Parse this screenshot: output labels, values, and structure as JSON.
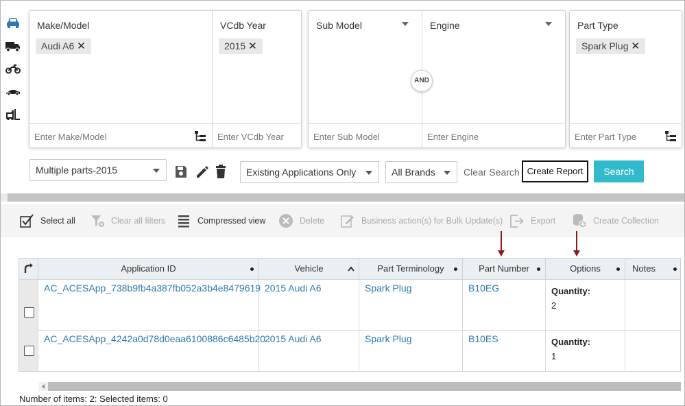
{
  "filters": {
    "make_model": {
      "header": "Make/Model",
      "chip": "Audi A6",
      "placeholder": "Enter Make/Model"
    },
    "vcdb_year": {
      "header": "VCdb Year",
      "chip": "2015",
      "placeholder": "Enter VCdb Year"
    },
    "sub_model": {
      "header": "Sub Model",
      "placeholder": "Enter Sub Model"
    },
    "engine": {
      "header": "Engine",
      "placeholder": "Enter Engine"
    },
    "and_label": "AND",
    "part_type": {
      "header": "Part Type",
      "chip": "Spark Plug",
      "placeholder": "Enter Part Type"
    }
  },
  "chip_remove_glyph": "✕",
  "controls": {
    "saved_search": "Multiple parts-2015",
    "applications_filter": "Existing Applications Only",
    "brands_filter": "All Brands",
    "clear_search": "Clear Search",
    "create_report": "Create Report",
    "search": "Search"
  },
  "toolbar": {
    "select_all": "Select all",
    "clear_filters": "Clear all filters",
    "compressed_view": "Compressed view",
    "delete": "Delete",
    "bulk_update": "Business action(s) for Bulk Update(s)",
    "export": "Export",
    "create_collection": "Create Collection"
  },
  "grid": {
    "columns": [
      "Application ID",
      "Vehicle",
      "Part Terminology",
      "Part Number",
      "Options",
      "Notes"
    ],
    "rows": [
      {
        "application_id": "AC_ACESApp_738b9fb4a387fb052a3b4e8479619",
        "vehicle": "2015 Audi A6",
        "part_terminology": "Spark Plug",
        "part_number": "B10EG",
        "option_label": "Quantity:",
        "option_value": "2",
        "notes": ""
      },
      {
        "application_id": "AC_ACESApp_4242a0d78d0eaa6100886c6485b20",
        "vehicle": "2015 Audi A6",
        "part_terminology": "Spark Plug",
        "part_number": "B10ES",
        "option_label": "Quantity:",
        "option_value": "1",
        "notes": ""
      }
    ]
  },
  "footer": "Number of items: 2: Selected items: 0",
  "colors": {
    "accent": "#31b9cc",
    "link": "#2f79b2",
    "arrow": "#8b1a1a",
    "car_icon": "#2f79b2"
  }
}
